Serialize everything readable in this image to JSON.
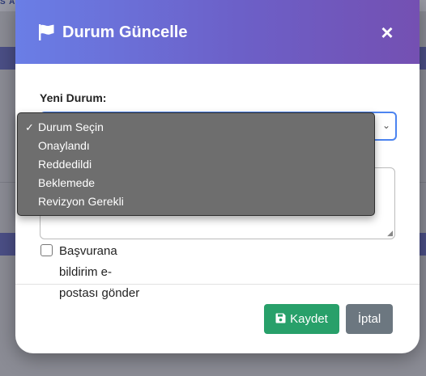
{
  "background": {
    "top_text": "S AT"
  },
  "modal": {
    "title": "Durum Güncelle",
    "close_label": "×",
    "status_label": "Yeni Durum:",
    "status_options": [
      "Durum Seçin",
      "Onaylandı",
      "Reddedildi",
      "Beklemede",
      "Revizyon Gerekli"
    ],
    "selected_option": "Durum Seçin",
    "notify_checkbox_label": "Başvurana bildirim e-postası gönder",
    "notify_checked": false,
    "save_button": "Kaydet",
    "cancel_button": "İptal"
  },
  "icons": {
    "title": "flag-icon",
    "save": "save-icon",
    "close": "close-icon"
  },
  "colors": {
    "header_start": "#6a7ee6",
    "header_end": "#7450b2",
    "save_button": "#28a06a",
    "cancel_button": "#6c7780",
    "select_focus": "#4c84f0"
  }
}
